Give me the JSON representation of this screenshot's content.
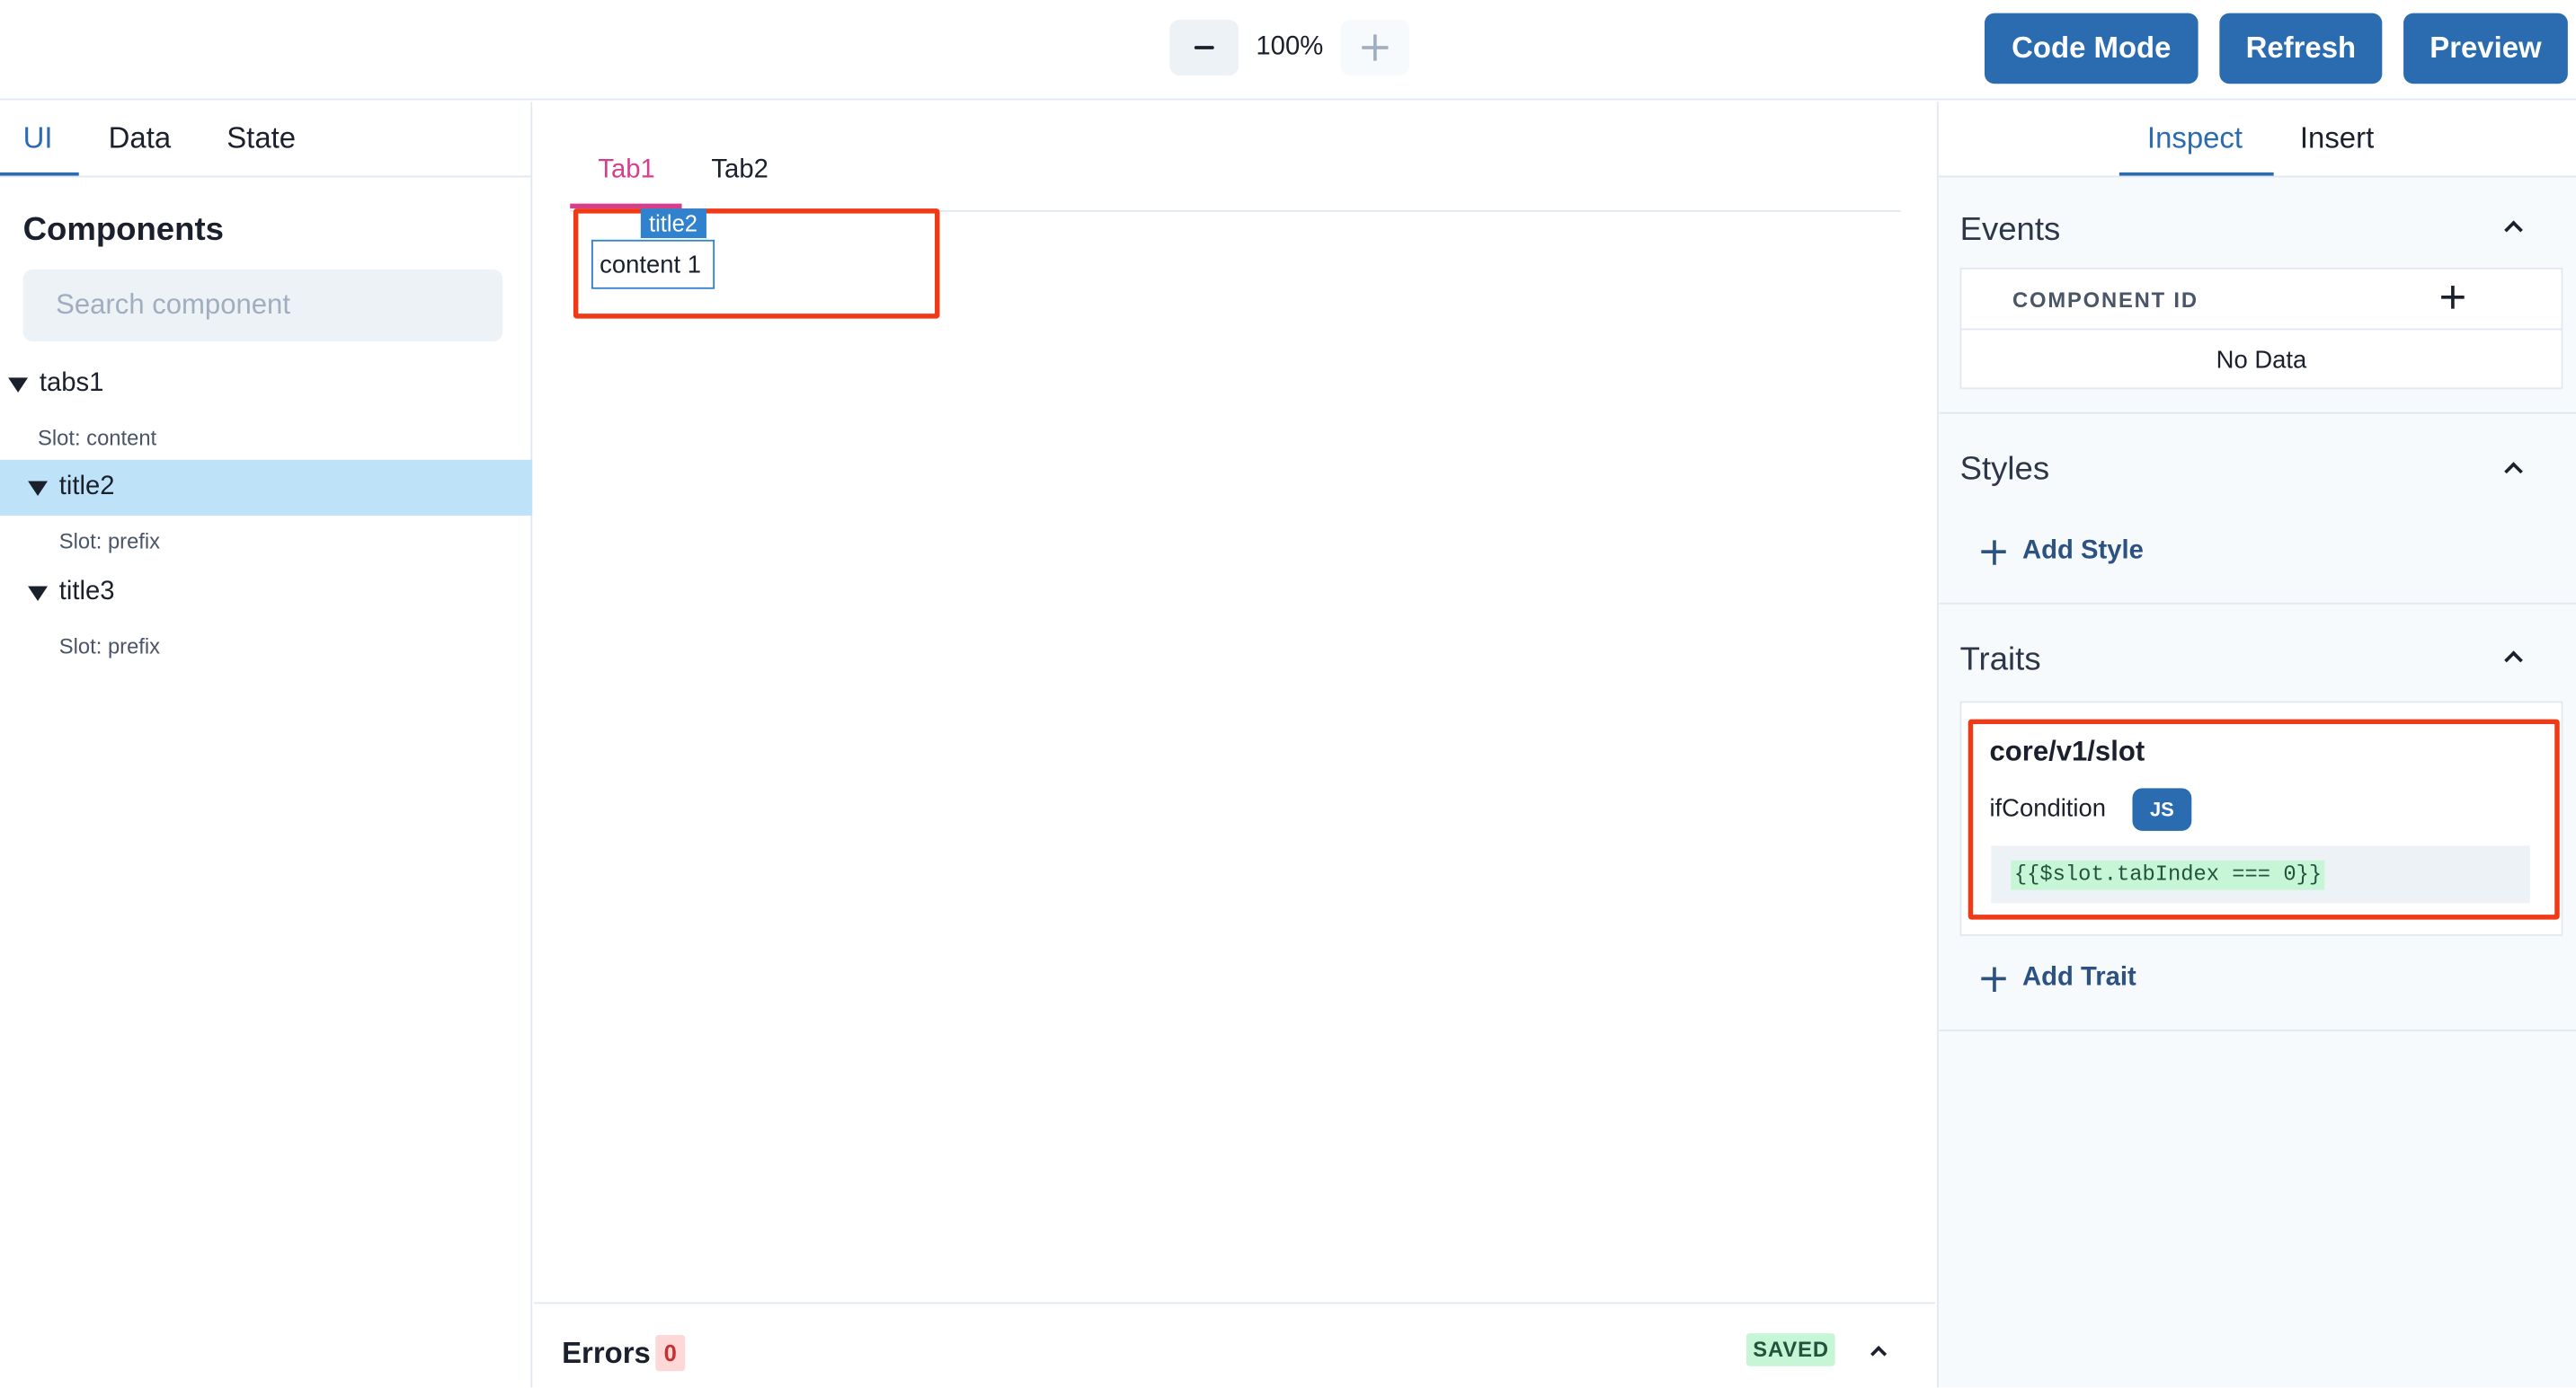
{
  "toolbar": {
    "zoom_value": "100%",
    "code_mode_label": "Code Mode",
    "refresh_label": "Refresh",
    "preview_label": "Preview"
  },
  "left_panel": {
    "tabs": [
      "UI",
      "Data",
      "State"
    ],
    "active_tab": "UI",
    "components_title": "Components",
    "search_placeholder": "Search component",
    "tree": [
      {
        "label": "tabs1",
        "slot": "Slot: content",
        "selected": false
      },
      {
        "label": "title2",
        "slot": "Slot: prefix",
        "selected": true
      },
      {
        "label": "title3",
        "slot": "Slot: prefix",
        "selected": false
      }
    ]
  },
  "canvas": {
    "tabs": [
      "Tab1",
      "Tab2"
    ],
    "active_tab": "Tab1",
    "title_tag": "title2",
    "content_text": "content 1",
    "errors_label": "Errors",
    "errors_count": "0",
    "save_status": "SAVED"
  },
  "right_panel": {
    "tabs": [
      "Inspect",
      "Insert"
    ],
    "active_tab": "Inspect",
    "events": {
      "title": "Events",
      "column_header": "COMPONENT ID",
      "empty_text": "No Data"
    },
    "styles": {
      "title": "Styles",
      "add_label": "Add Style"
    },
    "traits": {
      "title": "Traits",
      "trait_name": "core/v1/slot",
      "field_label": "ifCondition",
      "js_badge": "JS",
      "code": "{{$slot.tabIndex === 0}}",
      "add_label": "Add Trait"
    }
  },
  "colors": {
    "primary": "#2b6cb0",
    "active_tab_pink": "#d53f8c",
    "selected_row": "#bee3f8",
    "highlight_red": "#f03a17"
  }
}
